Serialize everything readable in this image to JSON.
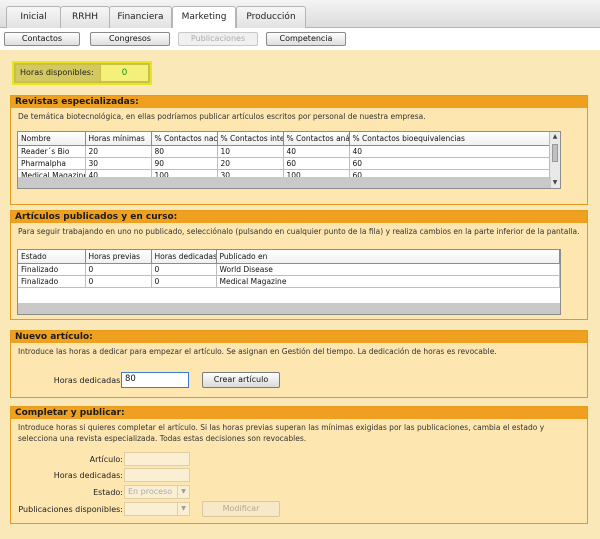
{
  "tabs": [
    "Inicial",
    "RRHH",
    "Financiera",
    "Marketing",
    "Producción"
  ],
  "subtabs": [
    "Contactos",
    "Congresos",
    "Publicaciones",
    "Competencia"
  ],
  "hours": {
    "label": "Horas disponibles:",
    "value": "0"
  },
  "revistas": {
    "title": "Revistas especializadas:",
    "description": "De temática biotecnológica, en ellas podríamos publicar artículos escritos por personal de nuestra empresa.",
    "columns": [
      "Nombre",
      "Horas mínimas",
      "% Contactos naci",
      "% Contactos inter",
      "% Contactos anál",
      "% Contactos bioequivalencias"
    ],
    "rows": [
      [
        "Reader´s Bio",
        "20",
        "80",
        "10",
        "40",
        "40"
      ],
      [
        "Pharmalpha",
        "30",
        "90",
        "20",
        "60",
        "60"
      ],
      [
        "Medical Magazine",
        "40",
        "100",
        "30",
        "100",
        "60"
      ]
    ]
  },
  "articulos": {
    "title": "Artículos publicados y en curso:",
    "description": "Para seguir trabajando en uno no publicado, selecciónalo (pulsando en cualquier punto de la fila) y realiza cambios en la parte inferior de la pantalla.",
    "columns": [
      "Estado",
      "Horas previas",
      "Horas dedicadas",
      "Publicado en"
    ],
    "rows": [
      [
        "Finalizado",
        "0",
        "0",
        "World Disease"
      ],
      [
        "Finalizado",
        "0",
        "0",
        "Medical Magazine"
      ]
    ]
  },
  "nuevo": {
    "title": "Nuevo artículo:",
    "description": "Introduce las horas a dedicar para empezar el artículo. Se asignan en Gestión del tiempo. La dedicación de horas es revocable.",
    "hours_label": "Horas dedicadas:",
    "hours_value": "80",
    "create_label": "Crear artículo"
  },
  "completar": {
    "title": "Completar y publicar:",
    "description": "Introduce horas si quieres completar el artículo. Si las horas previas superan las mínimas exigidas por las publicaciones, cambia el estado y selecciona una revista especializada. Todas estas decisiones son revocables.",
    "articulo_label": "Artículo:",
    "horas_label": "Horas dedicadas:",
    "estado_label": "Estado:",
    "estado_value": "En proceso",
    "pub_label": "Publicaciones disponibles:",
    "pub_value": "",
    "modificar_label": "Modificar"
  }
}
